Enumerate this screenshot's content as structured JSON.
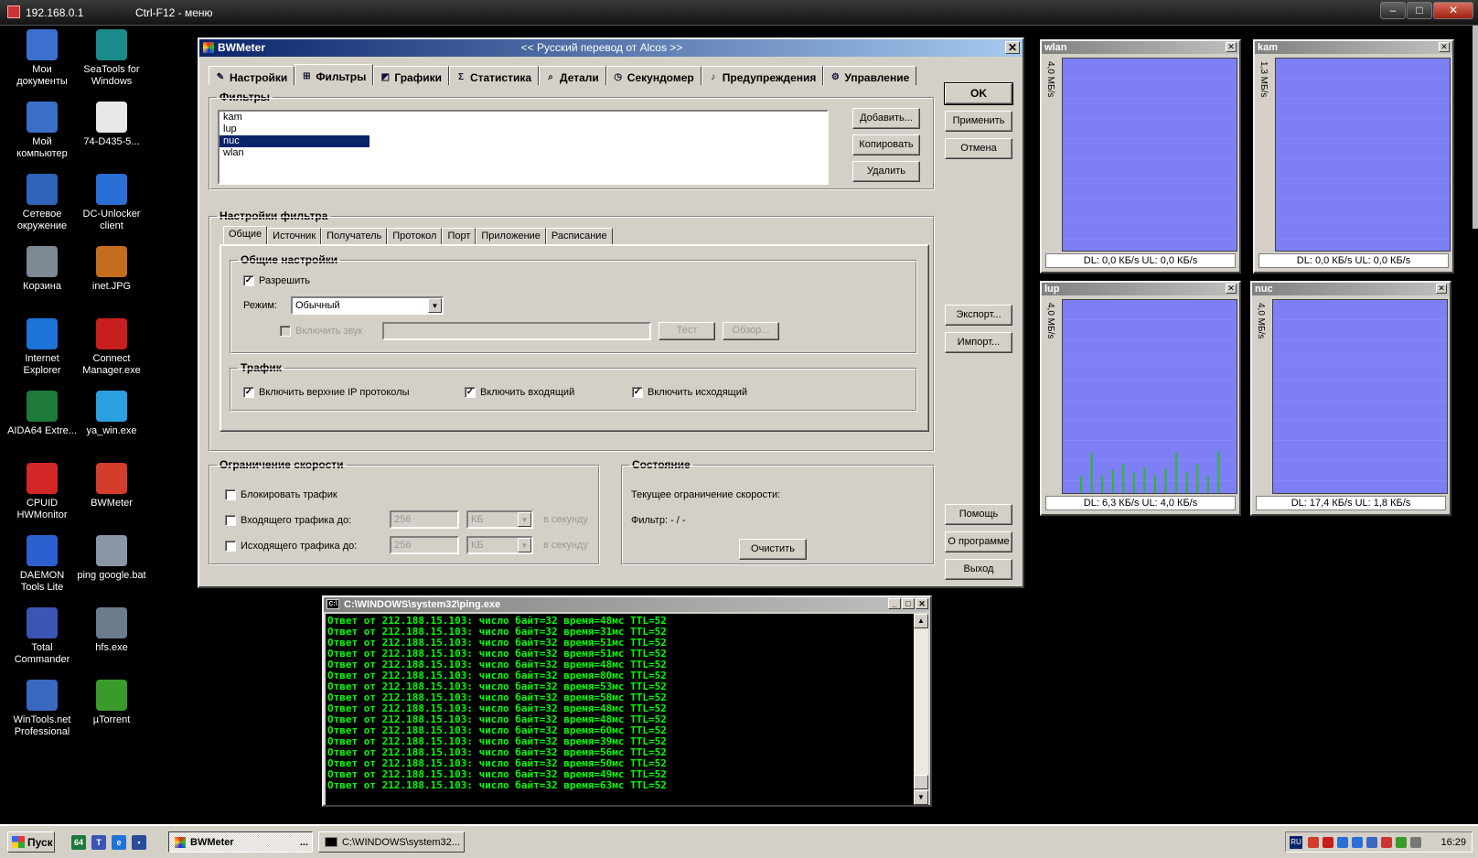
{
  "remote": {
    "address": "192.168.0.1",
    "menu_hint": "Ctrl-F12 - меню"
  },
  "desktop": {
    "icons": [
      {
        "label": "Мои документы",
        "icon": "folder-documents-icon",
        "color": "#3d6fd1"
      },
      {
        "label": "SeaTools for Windows",
        "icon": "seatools-icon",
        "color": "#1a8a8a"
      },
      {
        "label": "Мой компьютер",
        "icon": "my-computer-icon",
        "color": "#3b6fc7"
      },
      {
        "label": "74-D435-5...",
        "icon": "document-icon",
        "color": "#e8e8e8"
      },
      {
        "label": "Сетевое окружение",
        "icon": "network-icon",
        "color": "#2f64b9"
      },
      {
        "label": "DC-Unlocker client",
        "icon": "dc-unlocker-icon",
        "color": "#2a6fd6"
      },
      {
        "label": "Корзина",
        "icon": "recycle-bin-icon",
        "color": "#7d8a96"
      },
      {
        "label": "inet.JPG",
        "icon": "image-file-icon",
        "color": "#c46d1c"
      },
      {
        "label": "Internet Explorer",
        "icon": "internet-explorer-icon",
        "color": "#1e73d8"
      },
      {
        "label": "Connect Manager.exe",
        "icon": "connect-manager-icon",
        "color": "#c81e1e"
      },
      {
        "label": "AIDA64 Extre...",
        "icon": "aida64-icon",
        "color": "#1d7a3a"
      },
      {
        "label": "ya_win.exe",
        "icon": "ya-win-icon",
        "color": "#2aa0e0"
      },
      {
        "label": "CPUID HWMonitor",
        "icon": "hwmonitor-icon",
        "color": "#d22727"
      },
      {
        "label": "BWMeter",
        "icon": "bwmeter-icon",
        "color": "#d43c2c"
      },
      {
        "label": "DAEMON Tools Lite",
        "icon": "daemon-tools-icon",
        "color": "#2c5fd0"
      },
      {
        "label": "ping google.bat",
        "icon": "batch-file-icon",
        "color": "#8a96a8"
      },
      {
        "label": "Total Commander",
        "icon": "total-commander-icon",
        "color": "#3b55b5"
      },
      {
        "label": "hfs.exe",
        "icon": "hfs-icon",
        "color": "#6b7c8d"
      },
      {
        "label": "WinTools.net Professional",
        "icon": "wintools-icon",
        "color": "#3a68c0"
      },
      {
        "label": "µTorrent",
        "icon": "utorrent-icon",
        "color": "#3a9a2a"
      }
    ]
  },
  "bwmeter": {
    "title": "BWMeter",
    "subtitle": "<< Русский перевод от Alcos >>",
    "tabs": [
      {
        "label": "Настройки",
        "icon": "settings-icon",
        "glyph": "✎"
      },
      {
        "label": "Фильтры",
        "icon": "filters-icon",
        "glyph": "⊞",
        "active": true
      },
      {
        "label": "Графики",
        "icon": "graphs-icon",
        "glyph": "◩"
      },
      {
        "label": "Статистика",
        "icon": "statistics-icon",
        "glyph": "Σ"
      },
      {
        "label": "Детали",
        "icon": "details-icon",
        "glyph": "⌕"
      },
      {
        "label": "Секундомер",
        "icon": "stopwatch-icon",
        "glyph": "◷"
      },
      {
        "label": "Предупреждения",
        "icon": "alerts-icon",
        "glyph": "♪"
      },
      {
        "label": "Управление",
        "icon": "control-icon",
        "glyph": "⚙"
      }
    ],
    "filters_group": "Фильтры",
    "filters": [
      "kam",
      "lup",
      "nuc",
      "wlan"
    ],
    "selected_filter": 2,
    "buttons": {
      "add": "Добавить...",
      "copy": "Копировать",
      "delete": "Удалить",
      "ok": "OK",
      "apply": "Применить",
      "cancel": "Отмена",
      "export": "Экспорт...",
      "import": "Импорт...",
      "help": "Помощь",
      "about": "О программе",
      "exit": "Выход"
    },
    "filter_settings": {
      "group": "Настройки фильтра",
      "subtabs": [
        "Общие",
        "Источник",
        "Получатель",
        "Протокол",
        "Порт",
        "Приложение",
        "Расписание"
      ],
      "general": {
        "group": "Общие настройки",
        "enable_label": "Разрешить",
        "enable_checked": true,
        "mode_label": "Режим:",
        "mode_value": "Обычный",
        "sound_label": "Включить звук",
        "sound_path": "",
        "test_button": "Тест",
        "browse_button": "Обзор..."
      },
      "traffic": {
        "group": "Трафик",
        "upper_ip": "Включить верхние IP протоколы",
        "incoming": "Включить входящий",
        "outgoing": "Включить исходящий"
      }
    },
    "speed_limit": {
      "group": "Ограничение скорости",
      "block": "Блокировать трафик",
      "incoming_label": "Входящего трафика до:",
      "outgoing_label": "Исходящего трафика до:",
      "incoming_value": "256",
      "outgoing_value": "256",
      "unit": "КБ",
      "per_second": "в секунду"
    },
    "state": {
      "group": "Состояние",
      "current_limit": "Текущее ограничение скорости:",
      "filter": "Фильтр: - / -",
      "clear_button": "Очистить"
    }
  },
  "graphs": [
    {
      "name": "wlan",
      "axis": "4,0 МБ/s",
      "status": "DL: 0,0 КБ/s   UL: 0,0 КБ/s",
      "spikes": []
    },
    {
      "name": "kam",
      "axis": "1,3 МБ/s",
      "status": "DL: 0,0 КБ/s   UL: 0,0 КБ/s",
      "spikes": []
    },
    {
      "name": "lup",
      "axis": "4,0 МБ/s",
      "status": "DL: 6,3 КБ/s   UL: 4,0 КБ/s",
      "spikes": [
        0.3,
        0.7,
        0.3,
        0.4,
        0.5,
        0.35,
        0.45,
        0.3,
        0.42,
        0.7,
        0.36,
        0.5,
        0.3,
        0.72
      ]
    },
    {
      "name": "nuc",
      "axis": "4,0 МБ/s",
      "status": "DL: 17,4 КБ/s   UL: 1,8 КБ/s",
      "spikes": []
    }
  ],
  "console": {
    "title": "C:\\WINDOWS\\system32\\ping.exe",
    "lines": [
      "Ответ от 212.188.15.103: число байт=32 время=48мс TTL=52",
      "Ответ от 212.188.15.103: число байт=32 время=31мс TTL=52",
      "Ответ от 212.188.15.103: число байт=32 время=51мс TTL=52",
      "Ответ от 212.188.15.103: число байт=32 время=51мс TTL=52",
      "Ответ от 212.188.15.103: число байт=32 время=48мс TTL=52",
      "Ответ от 212.188.15.103: число байт=32 время=80мс TTL=52",
      "Ответ от 212.188.15.103: число байт=32 время=53мс TTL=52",
      "Ответ от 212.188.15.103: число байт=32 время=58мс TTL=52",
      "Ответ от 212.188.15.103: число байт=32 время=48мс TTL=52",
      "Ответ от 212.188.15.103: число байт=32 время=48мс TTL=52",
      "Ответ от 212.188.15.103: число байт=32 время=60мс TTL=52",
      "Ответ от 212.188.15.103: число байт=32 время=39мс TTL=52",
      "Ответ от 212.188.15.103: число байт=32 время=56мс TTL=52",
      "Ответ от 212.188.15.103: число байт=32 время=50мс TTL=52",
      "Ответ от 212.188.15.103: число байт=32 время=49мс TTL=52",
      "Ответ от 212.188.15.103: число байт=32 время=63мс TTL=52"
    ]
  },
  "taskbar": {
    "start": "Пуск",
    "windows": [
      "BWMeter",
      "C:\\WINDOWS\\system32..."
    ],
    "tray_lang": "RU",
    "clock": "16:29"
  }
}
